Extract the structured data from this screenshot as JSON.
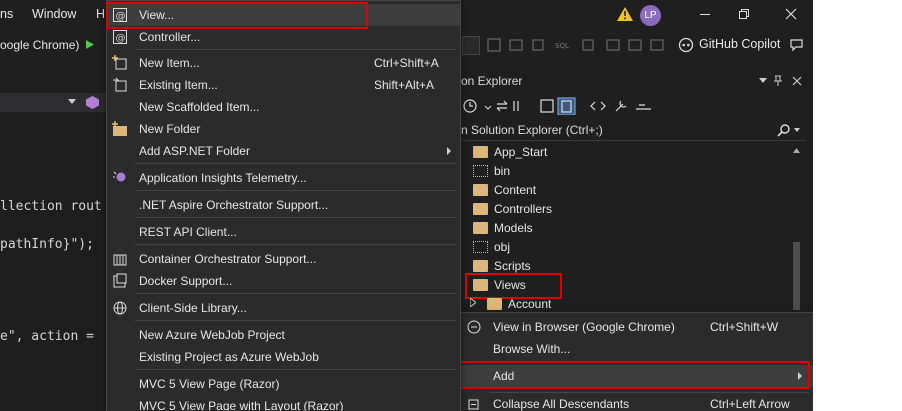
{
  "titlebar": {
    "menu_partial_left": "ns",
    "menu_window": "Window",
    "menu_partial_h": "H",
    "avatar_initials": "LP"
  },
  "toolbar": {
    "run_target": "oogle Chrome)",
    "copilot_label": "GitHub Copilot"
  },
  "editor": {
    "line1": "llection rout",
    "line2": "pathInfo}\");",
    "line3": "e\", action ="
  },
  "solution_explorer": {
    "title": "on Explorer",
    "search_placeholder": "n Solution Explorer (Ctrl+;)",
    "items": [
      {
        "label": "App_Start",
        "icon": "folder-icon"
      },
      {
        "label": "bin",
        "icon": "folder-dotted-icon"
      },
      {
        "label": "Content",
        "icon": "folder-icon"
      },
      {
        "label": "Controllers",
        "icon": "folder-icon"
      },
      {
        "label": "Models",
        "icon": "folder-icon"
      },
      {
        "label": "obj",
        "icon": "folder-dotted-icon"
      },
      {
        "label": "Scripts",
        "icon": "folder-icon"
      },
      {
        "label": "Views",
        "icon": "folder-icon"
      },
      {
        "label": "Account",
        "icon": "folder-icon"
      }
    ]
  },
  "add_menu": {
    "items": [
      {
        "label": "View...",
        "shortcut": "",
        "icon": "view-icon"
      },
      {
        "label": "Controller...",
        "shortcut": "",
        "icon": "controller-icon"
      },
      {
        "label": "New Item...",
        "shortcut": "Ctrl+Shift+A",
        "icon": "new-item-icon"
      },
      {
        "label": "Existing Item...",
        "shortcut": "Shift+Alt+A",
        "icon": "existing-item-icon"
      },
      {
        "label": "New Scaffolded Item...",
        "shortcut": "",
        "icon": ""
      },
      {
        "label": "New Folder",
        "shortcut": "",
        "icon": "new-folder-icon"
      },
      {
        "label": "Add ASP.NET Folder",
        "shortcut": "",
        "icon": ""
      },
      {
        "label": "Application Insights Telemetry...",
        "shortcut": "",
        "icon": "insights-icon"
      },
      {
        "label": ".NET Aspire Orchestrator Support...",
        "shortcut": "",
        "icon": ""
      },
      {
        "label": "REST API Client...",
        "shortcut": "",
        "icon": ""
      },
      {
        "label": "Container Orchestrator Support...",
        "shortcut": "",
        "icon": "container-icon"
      },
      {
        "label": "Docker Support...",
        "shortcut": "",
        "icon": "docker-icon"
      },
      {
        "label": "Client-Side Library...",
        "shortcut": "",
        "icon": "globe-icon"
      },
      {
        "label": "New Azure WebJob Project",
        "shortcut": "",
        "icon": ""
      },
      {
        "label": "Existing Project as Azure WebJob",
        "shortcut": "",
        "icon": ""
      },
      {
        "label": "MVC 5 View Page (Razor)",
        "shortcut": "",
        "icon": ""
      },
      {
        "label": "MVC 5 View Page with Layout (Razor)",
        "shortcut": "",
        "icon": ""
      }
    ]
  },
  "folder_menu": {
    "items": [
      {
        "label": "View in Browser (Google Chrome)",
        "shortcut": "Ctrl+Shift+W",
        "icon": "browser-icon"
      },
      {
        "label": "Browse With...",
        "shortcut": "",
        "icon": ""
      },
      {
        "label": "Add",
        "shortcut": "",
        "icon": ""
      },
      {
        "label": "Collapse All Descendants",
        "shortcut": "Ctrl+Left Arrow",
        "icon": "collapse-icon"
      }
    ]
  },
  "colors": {
    "highlight_border": "#e00000",
    "menu_bg": "#2b2b2b",
    "folder": "#dcb67a"
  }
}
